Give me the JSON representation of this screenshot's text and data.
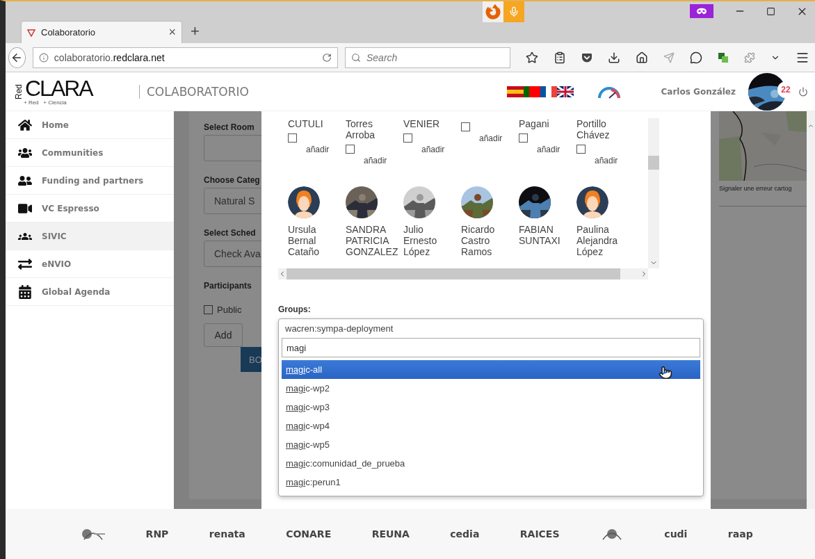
{
  "browser": {
    "tab": {
      "title": "Colaboratorio",
      "selected": true
    },
    "close_tab": "×",
    "new_tab": "+",
    "address": "colaboratorio.**redclara.net**",
    "search": {
      "placeholder": "Search"
    }
  },
  "header": {
    "logo": {
      "vertical": "Red",
      "name": "CLARA",
      "tagline": "+ Red   + Ciencia"
    },
    "app_title": "COLABORATORIO",
    "user": {
      "name": "Carlos González",
      "notifications": "22"
    }
  },
  "sidebar": {
    "items": [
      {
        "label": "Home",
        "selected": false
      },
      {
        "label": "Communities",
        "selected": false
      },
      {
        "label": "Funding and partners",
        "selected": false
      },
      {
        "label": "VC Espresso",
        "selected": false
      },
      {
        "label": "SIVIC",
        "selected": true
      },
      {
        "label": "eNVIO",
        "selected": false
      },
      {
        "label": "Global Agenda",
        "selected": false
      }
    ]
  },
  "form": {
    "room_label": "Select Room",
    "category": {
      "label": "Choose Categ",
      "value": "Natural S"
    },
    "schedule": {
      "label": "Select Sched",
      "value": "Check Ava"
    },
    "participants_label": "Participants",
    "public": {
      "label": "Public",
      "checked": false
    },
    "add_button": "Add",
    "submit_button": "BO"
  },
  "map": {
    "caption": "Signaler une erreur cartog"
  },
  "modal": {
    "members": [
      {
        "name": "CUTULI",
        "checked": false,
        "action": "añadir"
      },
      {
        "name": "Torres Arroba",
        "checked": false,
        "action": "añadir"
      },
      {
        "name": "VENIER",
        "checked": false,
        "action": "añadir"
      },
      {
        "checked": false,
        "action": "añadir"
      },
      {
        "name": "Pagani",
        "checked": false,
        "action": "añadir"
      },
      {
        "name": "Portillo Chávez",
        "checked": false,
        "action": "añadir"
      }
    ],
    "people": [
      {
        "name": "Ursula Bernal Cataño",
        "kind": "default"
      },
      {
        "name": "SANDRA PATRICIA GONZALEZ"
      },
      {
        "name": "Julio Ernesto López"
      },
      {
        "name": "Ricardo Castro Ramos"
      },
      {
        "name": "FABIAN SUNTAXI"
      },
      {
        "name": "Paulina Alejandra López",
        "kind": "default"
      }
    ],
    "groups": {
      "label": "Groups:",
      "chosen": [
        "wacren:sympa-deployment"
      ],
      "query": "magi",
      "options": [
        {
          "match": "magi",
          "rest": "c-all",
          "selected": true
        },
        {
          "match": "magi",
          "rest": "c-wp2",
          "selected": false
        },
        {
          "match": "magi",
          "rest": "c-wp3",
          "selected": false
        },
        {
          "match": "magi",
          "rest": "c-wp4",
          "selected": false
        },
        {
          "match": "magi",
          "rest": "c-wp5",
          "selected": false
        },
        {
          "match": "magi",
          "rest": "c:comunidad_de_prueba",
          "selected": false
        },
        {
          "match": "magi",
          "rest": "c:perun1",
          "selected": false
        }
      ]
    }
  },
  "partners": [
    {
      "kind": "mark"
    },
    {
      "kind": "text",
      "text": "RNP"
    },
    {
      "kind": "text",
      "text": "renata"
    },
    {
      "kind": "text",
      "text": "CONARE"
    },
    {
      "kind": "text",
      "text": "REUNA"
    },
    {
      "kind": "text",
      "text": "cedia"
    },
    {
      "kind": "text",
      "text": "RAICES"
    },
    {
      "kind": "mark"
    },
    {
      "kind": "text",
      "text": "cudi"
    },
    {
      "kind": "text",
      "text": "raap"
    }
  ]
}
